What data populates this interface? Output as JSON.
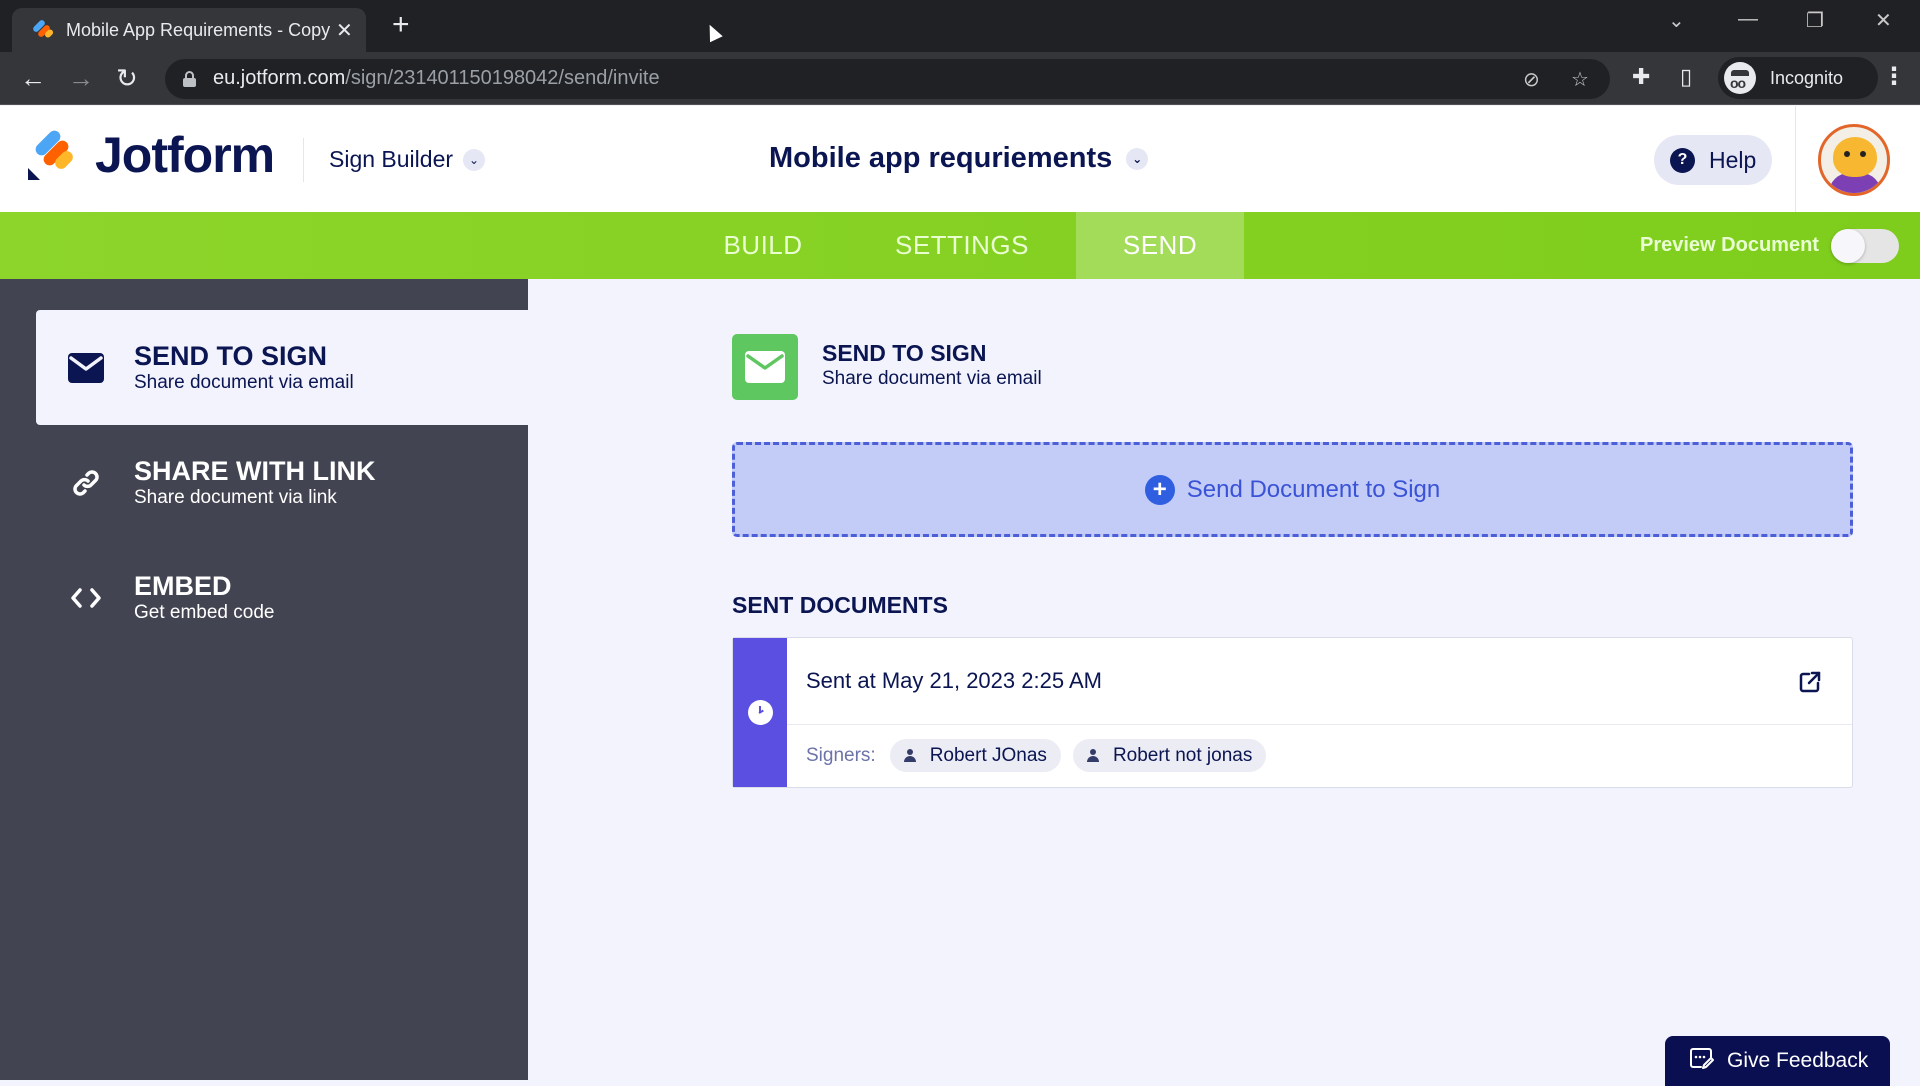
{
  "browser": {
    "tab_title": "Mobile App Requirements - Copy",
    "new_tab_label": "+",
    "url_host": "eu.jotform.com",
    "url_path": "/sign/231401150198042/send/invite",
    "profile_label": "Incognito"
  },
  "header": {
    "brand": "Jotform",
    "builder_label": "Sign Builder",
    "document_title": "Mobile app requriements",
    "help_label": "Help"
  },
  "nav": {
    "tabs": [
      {
        "label": "BUILD",
        "active": false
      },
      {
        "label": "SETTINGS",
        "active": false
      },
      {
        "label": "SEND",
        "active": true
      }
    ],
    "preview_label": "Preview Document",
    "preview_enabled": false
  },
  "sidebar": {
    "items": [
      {
        "title": "SEND TO SIGN",
        "subtitle": "Share document via email",
        "icon": "envelope-icon",
        "active": true
      },
      {
        "title": "SHARE WITH LINK",
        "subtitle": "Share document via link",
        "icon": "link-icon",
        "active": false
      },
      {
        "title": "EMBED",
        "subtitle": "Get embed code",
        "icon": "code-icon",
        "active": false
      }
    ]
  },
  "main": {
    "section_title": "SEND TO SIGN",
    "section_subtitle": "Share document via email",
    "send_button_label": "Send Document to Sign",
    "sent_heading": "SENT DOCUMENTS",
    "sent_documents": [
      {
        "sent_at": "Sent at May 21, 2023 2:25 AM",
        "signers_label": "Signers:",
        "signers": [
          "Robert JOnas",
          "Robert not jonas"
        ]
      }
    ]
  },
  "feedback": {
    "label": "Give Feedback"
  },
  "colors": {
    "green_nav": "#7ed321",
    "sidebar_bg": "#424551",
    "brand_navy": "#0a1551",
    "accent_blue": "#2f5ee0",
    "status_purple": "#5a4fe0"
  }
}
